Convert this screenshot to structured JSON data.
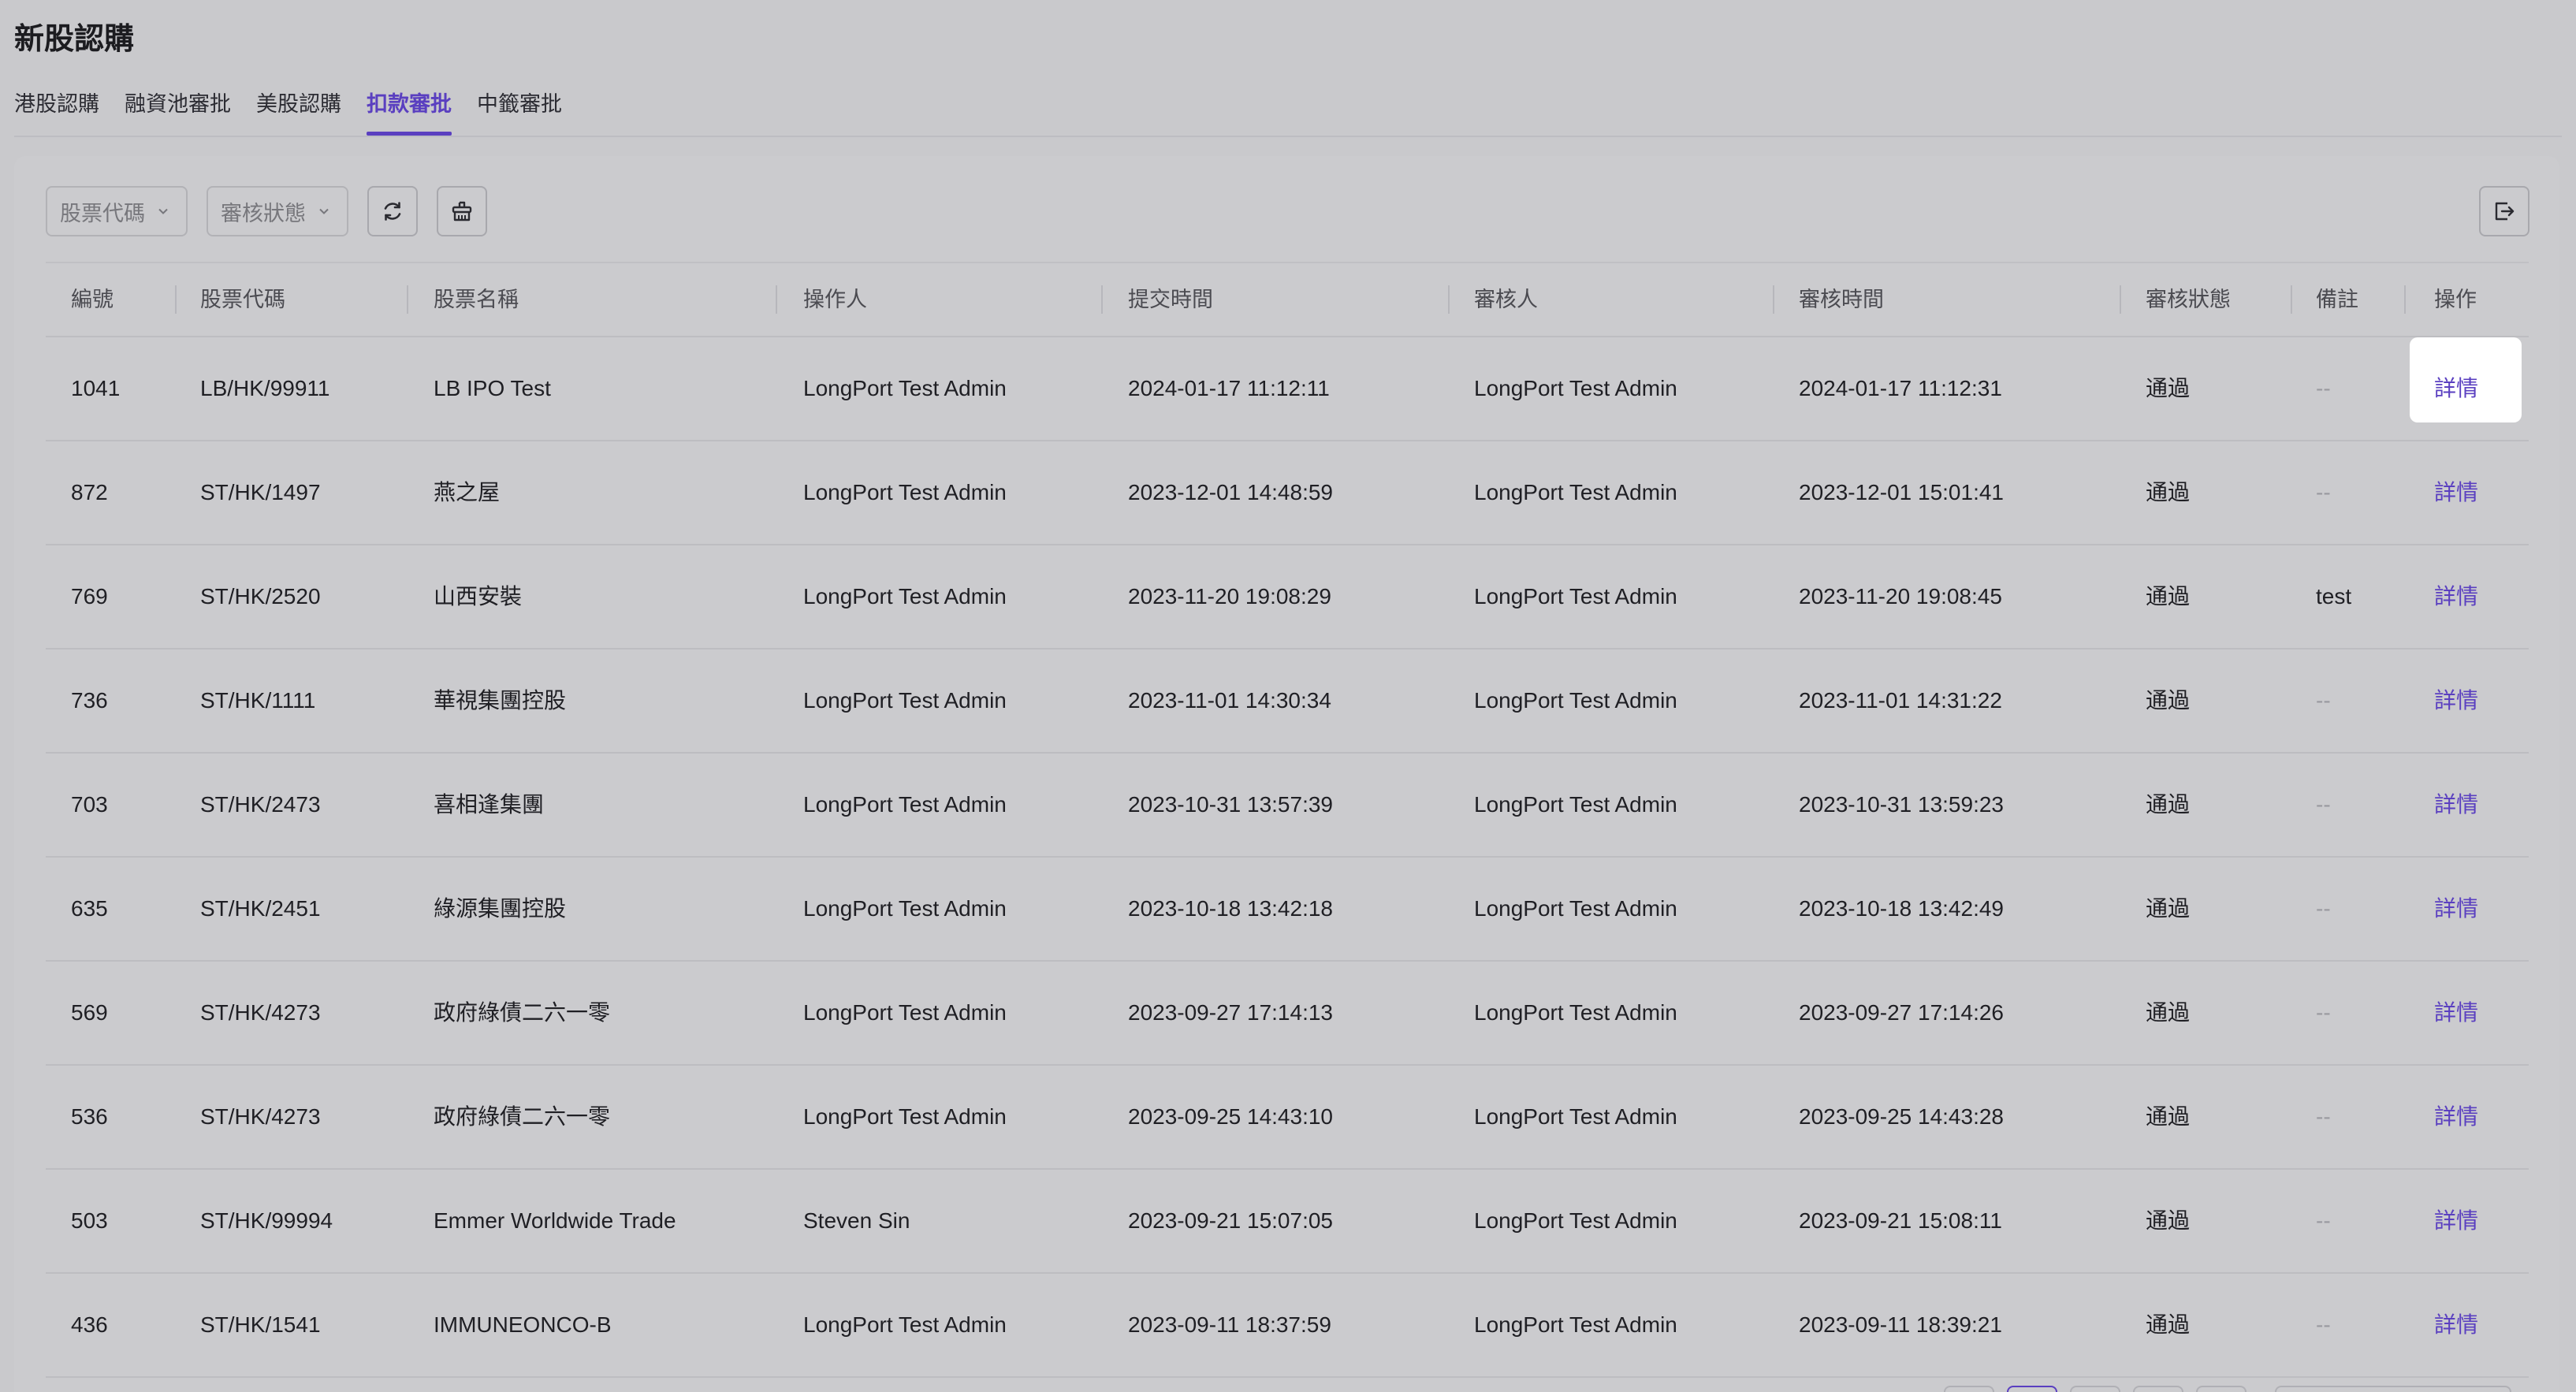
{
  "page": {
    "title": "新股認購"
  },
  "tabs": [
    {
      "label": "港股認購",
      "active": false
    },
    {
      "label": "融資池審批",
      "active": false
    },
    {
      "label": "美股認購",
      "active": false
    },
    {
      "label": "扣款審批",
      "active": true
    },
    {
      "label": "中籤審批",
      "active": false
    }
  ],
  "toolbar": {
    "stock_code_placeholder": "股票代碼",
    "status_placeholder": "審核狀態"
  },
  "table": {
    "headers": [
      "編號",
      "股票代碼",
      "股票名稱",
      "操作人",
      "提交時間",
      "審核人",
      "審核時間",
      "審核狀態",
      "備註",
      "操作"
    ],
    "rows": [
      {
        "id": "1041",
        "code": "LB/HK/99911",
        "name": "LB IPO Test",
        "operator": "LongPort Test Admin",
        "submitted": "2024-01-17 11:12:11",
        "reviewer": "LongPort Test Admin",
        "reviewed": "2024-01-17 11:12:31",
        "status": "通過",
        "note": "--",
        "action": "詳情"
      },
      {
        "id": "872",
        "code": "ST/HK/1497",
        "name": "燕之屋",
        "operator": "LongPort Test Admin",
        "submitted": "2023-12-01 14:48:59",
        "reviewer": "LongPort Test Admin",
        "reviewed": "2023-12-01 15:01:41",
        "status": "通過",
        "note": "--",
        "action": "詳情"
      },
      {
        "id": "769",
        "code": "ST/HK/2520",
        "name": "山西安裝",
        "operator": "LongPort Test Admin",
        "submitted": "2023-11-20 19:08:29",
        "reviewer": "LongPort Test Admin",
        "reviewed": "2023-11-20 19:08:45",
        "status": "通過",
        "note": "test",
        "action": "詳情"
      },
      {
        "id": "736",
        "code": "ST/HK/1111",
        "name": "華視集團控股",
        "operator": "LongPort Test Admin",
        "submitted": "2023-11-01 14:30:34",
        "reviewer": "LongPort Test Admin",
        "reviewed": "2023-11-01 14:31:22",
        "status": "通過",
        "note": "--",
        "action": "詳情"
      },
      {
        "id": "703",
        "code": "ST/HK/2473",
        "name": "喜相逢集團",
        "operator": "LongPort Test Admin",
        "submitted": "2023-10-31 13:57:39",
        "reviewer": "LongPort Test Admin",
        "reviewed": "2023-10-31 13:59:23",
        "status": "通過",
        "note": "--",
        "action": "詳情"
      },
      {
        "id": "635",
        "code": "ST/HK/2451",
        "name": "綠源集團控股",
        "operator": "LongPort Test Admin",
        "submitted": "2023-10-18 13:42:18",
        "reviewer": "LongPort Test Admin",
        "reviewed": "2023-10-18 13:42:49",
        "status": "通過",
        "note": "--",
        "action": "詳情"
      },
      {
        "id": "569",
        "code": "ST/HK/4273",
        "name": "政府綠債二六一零",
        "operator": "LongPort Test Admin",
        "submitted": "2023-09-27 17:14:13",
        "reviewer": "LongPort Test Admin",
        "reviewed": "2023-09-27 17:14:26",
        "status": "通過",
        "note": "--",
        "action": "詳情"
      },
      {
        "id": "536",
        "code": "ST/HK/4273",
        "name": "政府綠債二六一零",
        "operator": "LongPort Test Admin",
        "submitted": "2023-09-25 14:43:10",
        "reviewer": "LongPort Test Admin",
        "reviewed": "2023-09-25 14:43:28",
        "status": "通過",
        "note": "--",
        "action": "詳情"
      },
      {
        "id": "503",
        "code": "ST/HK/99994",
        "name": "Emmer Worldwide Trade",
        "operator": "Steven Sin",
        "submitted": "2023-09-21 15:07:05",
        "reviewer": "LongPort Test Admin",
        "reviewed": "2023-09-21 15:08:11",
        "status": "通過",
        "note": "--",
        "action": "詳情"
      },
      {
        "id": "436",
        "code": "ST/HK/1541",
        "name": "IMMUNEONCO-B",
        "operator": "LongPort Test Admin",
        "submitted": "2023-09-11 18:37:59",
        "reviewer": "LongPort Test Admin",
        "reviewed": "2023-09-11 18:39:21",
        "status": "通過",
        "note": "--",
        "action": "詳情"
      }
    ]
  },
  "colors": {
    "accent": "#5a3fc0",
    "background": "#c9c9cc",
    "text": "#1f1f24"
  }
}
